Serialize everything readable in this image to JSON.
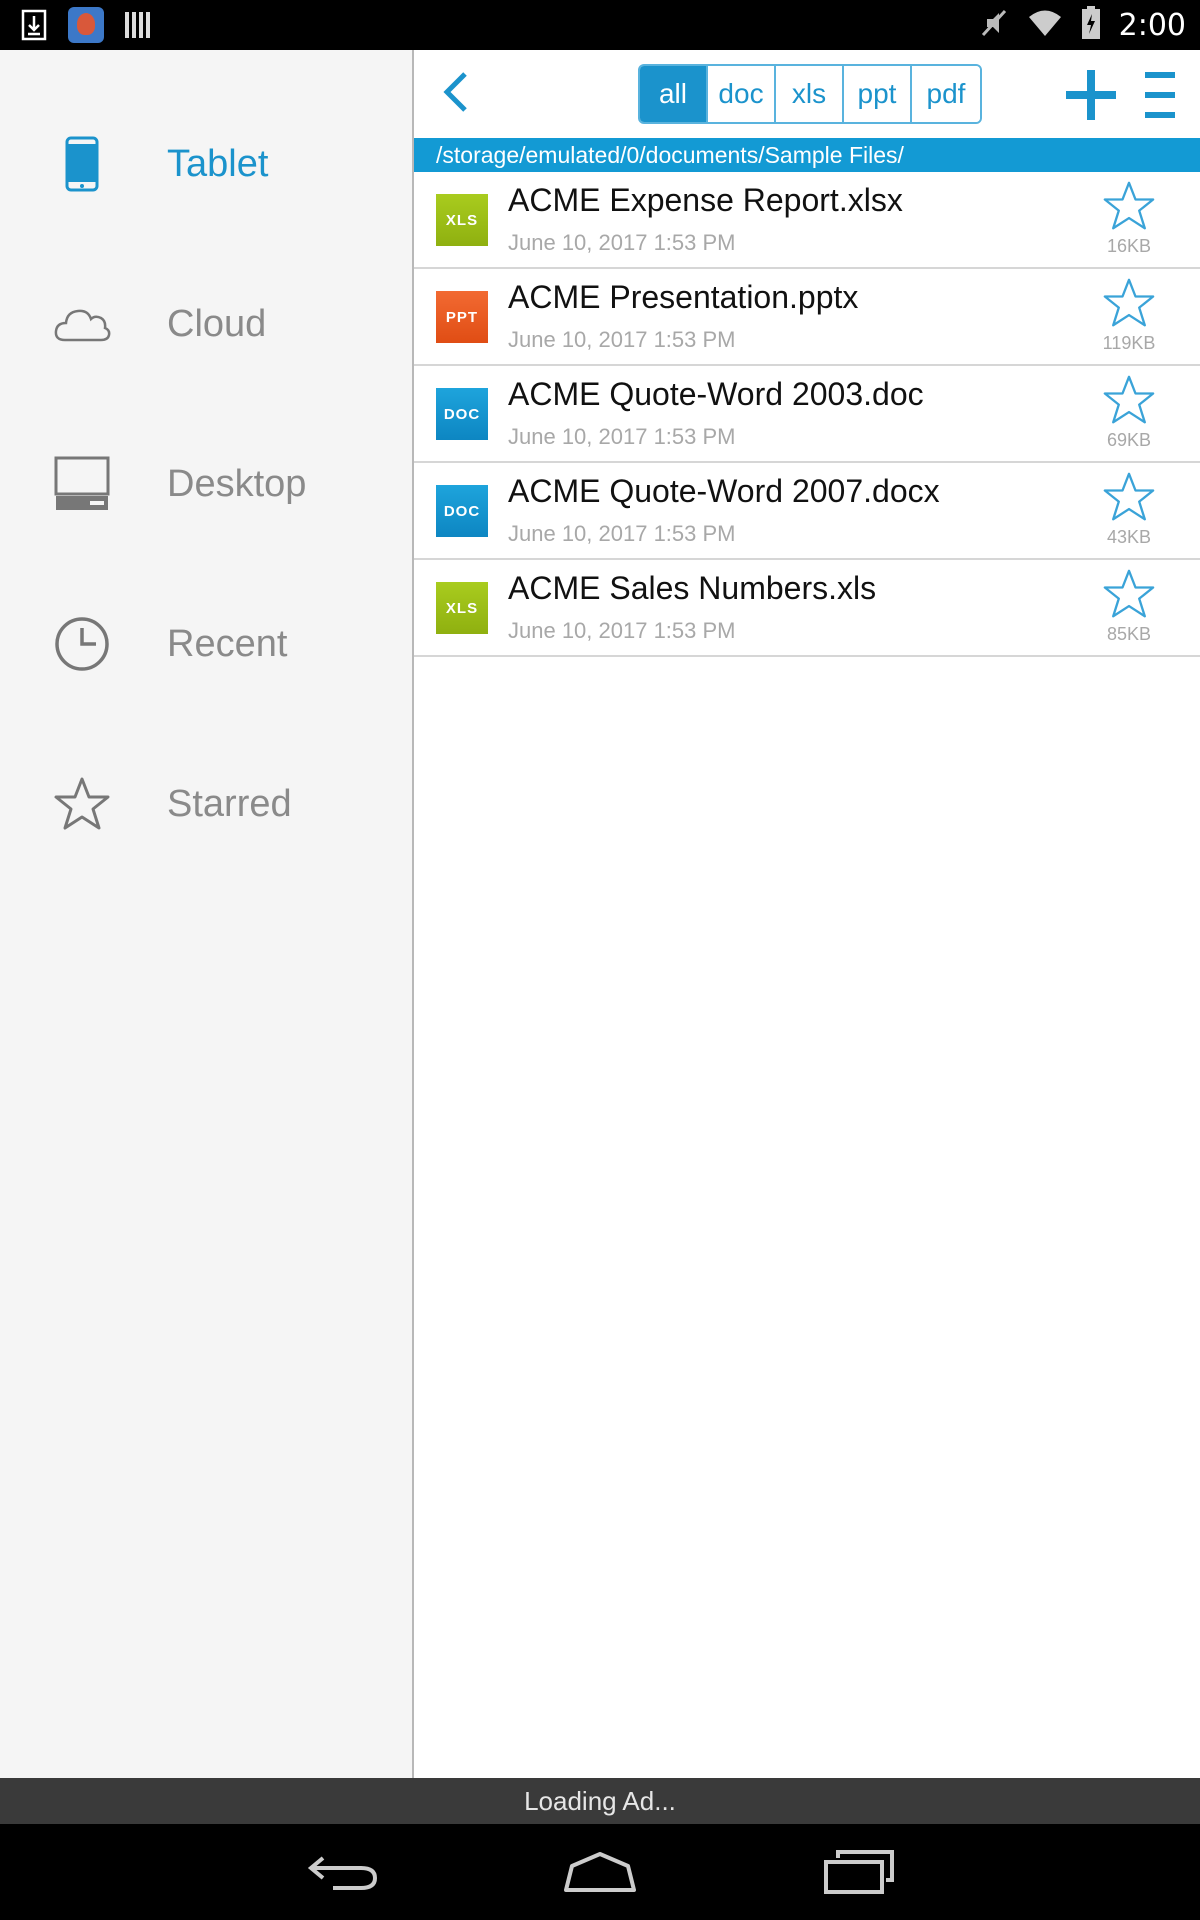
{
  "status_bar": {
    "time": "2:00",
    "left_icons": [
      "download-icon",
      "app-icon",
      "barcode-icon"
    ],
    "right_icons": [
      "mute-icon",
      "wifi-icon",
      "battery-icon"
    ]
  },
  "sidebar": {
    "items": [
      {
        "label": "Tablet",
        "icon": "tablet-icon",
        "active": true
      },
      {
        "label": "Cloud",
        "icon": "cloud-icon",
        "active": false
      },
      {
        "label": "Desktop",
        "icon": "desktop-icon",
        "active": false
      },
      {
        "label": "Recent",
        "icon": "clock-icon",
        "active": false
      },
      {
        "label": "Starred",
        "icon": "star-icon",
        "active": false
      }
    ]
  },
  "toolbar": {
    "filters": [
      "all",
      "doc",
      "xls",
      "ppt",
      "pdf"
    ],
    "active_filter": "all"
  },
  "path": "/storage/emulated/0/documents/Sample Files/",
  "files": [
    {
      "badge": "XLS",
      "type": "xls",
      "name": "ACME Expense Report.xlsx",
      "date": "June 10, 2017 1:53 PM",
      "size": "16KB"
    },
    {
      "badge": "PPT",
      "type": "ppt",
      "name": "ACME Presentation.pptx",
      "date": "June 10, 2017 1:53 PM",
      "size": "119KB"
    },
    {
      "badge": "DOC",
      "type": "doc",
      "name": "ACME Quote-Word 2003.doc",
      "date": "June 10, 2017 1:53 PM",
      "size": "69KB"
    },
    {
      "badge": "DOC",
      "type": "doc",
      "name": "ACME Quote-Word 2007.docx",
      "date": "June 10, 2017 1:53 PM",
      "size": "43KB"
    },
    {
      "badge": "XLS",
      "type": "xls",
      "name": "ACME Sales Numbers.xls",
      "date": "June 10, 2017 1:53 PM",
      "size": "85KB"
    }
  ],
  "ad": {
    "text": "Loading Ad..."
  },
  "colors": {
    "accent": "#1b93cc",
    "path_bar": "#139ad4",
    "sidebar_bg": "#f5f5f5"
  }
}
